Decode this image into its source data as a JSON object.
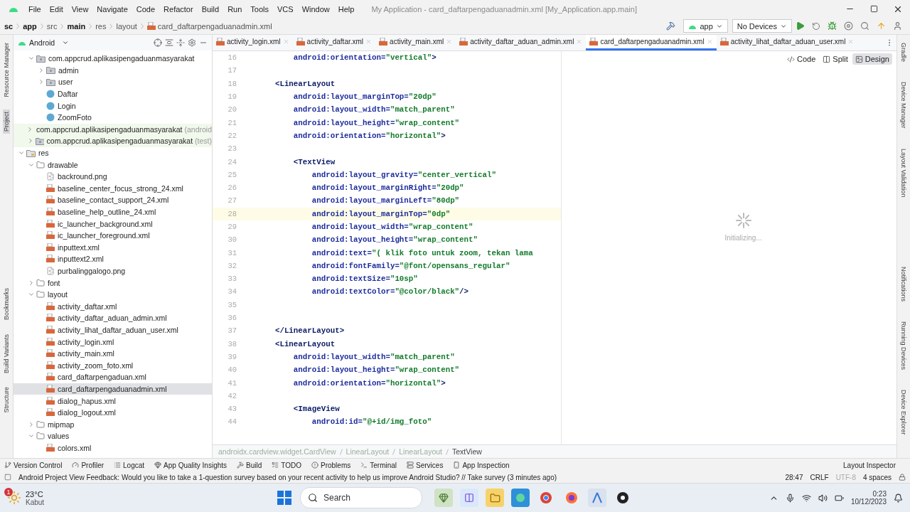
{
  "menu": [
    "File",
    "Edit",
    "View",
    "Navigate",
    "Code",
    "Refactor",
    "Build",
    "Run",
    "Tools",
    "VCS",
    "Window",
    "Help"
  ],
  "window": {
    "title": "My Application - card_daftarpengaduanadmin.xml [My_Application.app.main]"
  },
  "breadcrumb": [
    {
      "label": "sc",
      "bold": true
    },
    {
      "label": "app",
      "bold": true
    },
    {
      "label": "src",
      "bold": false
    },
    {
      "label": "main",
      "bold": true
    },
    {
      "label": "res",
      "bold": false
    },
    {
      "label": "layout",
      "bold": false
    },
    {
      "label": "card_daftarpengaduanadmin.xml",
      "bold": false
    }
  ],
  "run_config": "app",
  "device": "No Devices",
  "left_strip": [
    {
      "label": "Resource Manager",
      "selected": false
    },
    {
      "label": "Project",
      "selected": true
    },
    {
      "label": "Bookmarks",
      "selected": false
    },
    {
      "label": "Build Variants",
      "selected": false
    },
    {
      "label": "Structure",
      "selected": false
    }
  ],
  "right_strip": [
    "Gradle",
    "Device Manager",
    "Layout Validation",
    "Notifications",
    "Running Devices",
    "Device Explorer"
  ],
  "project": {
    "view": "Android",
    "tree": [
      {
        "children": [
          {
            "label": "com.appcrud.aplikasipengaduanmasyarakat",
            "kind": "package",
            "expanded": true,
            "test": false,
            "children": [
              {
                "label": "admin",
                "kind": "package",
                "expanded": false,
                "test": false
              },
              {
                "label": "user",
                "kind": "package",
                "expanded": false,
                "test": false
              },
              {
                "label": "Daftar",
                "kind": "class"
              },
              {
                "label": "Login",
                "kind": "class"
              },
              {
                "label": "ZoomFoto",
                "kind": "class"
              }
            ]
          },
          {
            "label": "com.appcrud.aplikasipengaduanmasyarakat",
            "suffix": "(android",
            "kind": "package",
            "expanded": false,
            "test": true
          },
          {
            "label": "com.appcrud.aplikasipengaduanmasyarakat",
            "suffix": "(test)",
            "kind": "package",
            "expanded": false,
            "test": true
          }
        ]
      },
      {
        "label": "res",
        "kind": "res",
        "expanded": true,
        "test": false,
        "children": [
          {
            "label": "drawable",
            "kind": "folder",
            "expanded": true,
            "test": false,
            "children": [
              {
                "label": "backround.png",
                "kind": "image"
              },
              {
                "label": "baseline_center_focus_strong_24.xml",
                "kind": "xml"
              },
              {
                "label": "baseline_contact_support_24.xml",
                "kind": "xml"
              },
              {
                "label": "baseline_help_outline_24.xml",
                "kind": "xml"
              },
              {
                "label": "ic_launcher_background.xml",
                "kind": "xml"
              },
              {
                "label": "ic_launcher_foreground.xml",
                "kind": "xml"
              },
              {
                "label": "inputtext.xml",
                "kind": "xml"
              },
              {
                "label": "inputtext2.xml",
                "kind": "xml"
              },
              {
                "label": "purbalinggalogo.png",
                "kind": "image"
              }
            ]
          },
          {
            "label": "font",
            "kind": "folder",
            "expanded": false,
            "test": false
          },
          {
            "label": "layout",
            "kind": "folder",
            "expanded": true,
            "test": false,
            "children": [
              {
                "label": "activity_daftar.xml",
                "kind": "xml",
                "selected": false
              },
              {
                "label": "activity_daftar_aduan_admin.xml",
                "kind": "xml",
                "selected": false
              },
              {
                "label": "activity_lihat_daftar_aduan_user.xml",
                "kind": "xml",
                "selected": false
              },
              {
                "label": "activity_login.xml",
                "kind": "xml",
                "selected": false
              },
              {
                "label": "activity_main.xml",
                "kind": "xml",
                "selected": false
              },
              {
                "label": "activity_zoom_foto.xml",
                "kind": "xml",
                "selected": false
              },
              {
                "label": "card_daftarpengaduan.xml",
                "kind": "xml",
                "selected": false
              },
              {
                "label": "card_daftarpengaduanadmin.xml",
                "kind": "xml",
                "selected": true
              },
              {
                "label": "dialog_hapus.xml",
                "kind": "xml",
                "selected": false
              },
              {
                "label": "dialog_logout.xml",
                "kind": "xml",
                "selected": false
              }
            ]
          },
          {
            "label": "mipmap",
            "kind": "folder",
            "expanded": false,
            "test": false
          },
          {
            "label": "values",
            "kind": "folder",
            "expanded": true,
            "test": false,
            "children": [
              {
                "label": "colors.xml",
                "kind": "xml"
              }
            ]
          }
        ]
      }
    ]
  },
  "tabs": [
    {
      "label": "activity_login.xml",
      "selected": false
    },
    {
      "label": "activity_daftar.xml",
      "selected": false
    },
    {
      "label": "activity_main.xml",
      "selected": false
    },
    {
      "label": "activity_daftar_aduan_admin.xml",
      "selected": false
    },
    {
      "label": "card_daftarpengaduanadmin.xml",
      "selected": true
    },
    {
      "label": "activity_lihat_daftar_aduan_user.xml",
      "selected": false
    }
  ],
  "view_modes": [
    {
      "label": "Code",
      "selected": false
    },
    {
      "label": "Split",
      "selected": false
    },
    {
      "label": "Design",
      "selected": true
    }
  ],
  "code": [
    {
      "number": "16",
      "current": false,
      "tokens": [
        {
          "kind": "attr",
          "text": "        android:orientation="
        },
        {
          "kind": "value",
          "text": "\"vertical\""
        },
        {
          "kind": "tag",
          "text": ">"
        }
      ]
    },
    {
      "number": "17",
      "current": false
    },
    {
      "number": "18",
      "current": false,
      "tokens": [
        {
          "kind": "tag",
          "text": "    <LinearLayout"
        }
      ]
    },
    {
      "number": "19",
      "current": false,
      "tokens": [
        {
          "kind": "attr",
          "text": "        android:layout_marginTop="
        },
        {
          "kind": "value",
          "text": "\"20dp\""
        }
      ]
    },
    {
      "number": "20",
      "current": false,
      "tokens": [
        {
          "kind": "attr",
          "text": "        android:layout_width="
        },
        {
          "kind": "value",
          "text": "\"match_parent\""
        }
      ]
    },
    {
      "number": "21",
      "current": false,
      "tokens": [
        {
          "kind": "attr",
          "text": "        android:layout_height="
        },
        {
          "kind": "value",
          "text": "\"wrap_content\""
        }
      ]
    },
    {
      "number": "22",
      "current": false,
      "tokens": [
        {
          "kind": "attr",
          "text": "        android:orientation="
        },
        {
          "kind": "value",
          "text": "\"horizontal\""
        },
        {
          "kind": "tag",
          "text": ">"
        }
      ]
    },
    {
      "number": "23",
      "current": false
    },
    {
      "number": "24",
      "current": false,
      "tokens": [
        {
          "kind": "tag",
          "text": "        <TextView"
        }
      ]
    },
    {
      "number": "25",
      "current": false,
      "tokens": [
        {
          "kind": "attr",
          "text": "            android:layout_gravity="
        },
        {
          "kind": "value",
          "text": "\"center_vertical\""
        }
      ]
    },
    {
      "number": "26",
      "current": false,
      "tokens": [
        {
          "kind": "attr",
          "text": "            android:layout_marginRight="
        },
        {
          "kind": "value",
          "text": "\"20dp\""
        }
      ]
    },
    {
      "number": "27",
      "current": false,
      "tokens": [
        {
          "kind": "attr",
          "text": "            android:layout_marginLeft="
        },
        {
          "kind": "value",
          "text": "\"80dp\""
        }
      ]
    },
    {
      "number": "28",
      "current": true,
      "tokens": [
        {
          "kind": "attr",
          "text": "            android:layout_marginTop="
        },
        {
          "kind": "value",
          "text": "\"0dp\""
        }
      ]
    },
    {
      "number": "29",
      "current": false,
      "tokens": [
        {
          "kind": "attr",
          "text": "            android:layout_width="
        },
        {
          "kind": "value",
          "text": "\"wrap_content\""
        }
      ]
    },
    {
      "number": "30",
      "current": false,
      "tokens": [
        {
          "kind": "attr",
          "text": "            android:layout_height="
        },
        {
          "kind": "value",
          "text": "\"wrap_content\""
        }
      ]
    },
    {
      "number": "31",
      "current": false,
      "tokens": [
        {
          "kind": "attr",
          "text": "            android:text="
        },
        {
          "kind": "value",
          "text": "\"( klik foto untuk zoom, tekan lama"
        }
      ]
    },
    {
      "number": "32",
      "current": false,
      "tokens": [
        {
          "kind": "attr",
          "text": "            android:fontFamily="
        },
        {
          "kind": "value",
          "text": "\"@font/opensans_regular\""
        }
      ]
    },
    {
      "number": "33",
      "current": false,
      "tokens": [
        {
          "kind": "attr",
          "text": "            android:textSize="
        },
        {
          "kind": "value",
          "text": "\"10sp\""
        }
      ]
    },
    {
      "number": "34",
      "current": false,
      "tokens": [
        {
          "kind": "attr",
          "text": "            android:textColor="
        },
        {
          "kind": "value",
          "text": "\"@color/black\""
        },
        {
          "kind": "tag",
          "text": "/>"
        }
      ]
    },
    {
      "number": "35",
      "current": false
    },
    {
      "number": "36",
      "current": false
    },
    {
      "number": "37",
      "current": false,
      "tokens": [
        {
          "kind": "tag",
          "text": "    </LinearLayout>"
        }
      ]
    },
    {
      "number": "38",
      "current": false,
      "tokens": [
        {
          "kind": "tag",
          "text": "    <LinearLayout"
        }
      ]
    },
    {
      "number": "39",
      "current": false,
      "tokens": [
        {
          "kind": "attr",
          "text": "        android:layout_width="
        },
        {
          "kind": "value",
          "text": "\"match_parent\""
        }
      ]
    },
    {
      "number": "40",
      "current": false,
      "tokens": [
        {
          "kind": "attr",
          "text": "        android:layout_height="
        },
        {
          "kind": "value",
          "text": "\"wrap_content\""
        }
      ]
    },
    {
      "number": "41",
      "current": false,
      "tokens": [
        {
          "kind": "attr",
          "text": "        android:orientation="
        },
        {
          "kind": "value",
          "text": "\"horizontal\""
        },
        {
          "kind": "tag",
          "text": ">"
        }
      ]
    },
    {
      "number": "42",
      "current": false
    },
    {
      "number": "43",
      "current": false,
      "tokens": [
        {
          "kind": "tag",
          "text": "        <ImageView"
        }
      ]
    },
    {
      "number": "44",
      "current": false,
      "tokens": [
        {
          "kind": "attr",
          "text": "            android:id="
        },
        {
          "kind": "value",
          "text": "\"@+id/img_foto\""
        }
      ]
    }
  ],
  "design": {
    "status": "Initializing..."
  },
  "editor_breadcrumb": [
    {
      "label": "androidx.cardview.widget.CardView",
      "selected": false
    },
    {
      "label": "LinearLayout",
      "selected": false
    },
    {
      "label": "LinearLayout",
      "selected": false
    },
    {
      "label": "TextView",
      "selected": true
    }
  ],
  "tool_windows": [
    "Version Control",
    "Profiler",
    "Logcat",
    "App Quality Insights",
    "Build",
    "TODO",
    "Problems",
    "Terminal",
    "Services",
    "App Inspection"
  ],
  "tool_windows_right": "Layout Inspector",
  "status_bar": {
    "message": "Android Project View Feedback: Would you like to take a 1-question survey based on your recent activity to help us improve Android Studio? // Take survey (3 minutes ago)",
    "position": "28:47",
    "line_separator": "CRLF",
    "encoding": "UTF-8",
    "indent": "4 spaces"
  },
  "taskbar": {
    "weather_badge": "1",
    "temperature": "23°C",
    "weather": "Kabut",
    "search_placeholder": "Search",
    "time": "0:23",
    "date": "10/12/2023"
  }
}
